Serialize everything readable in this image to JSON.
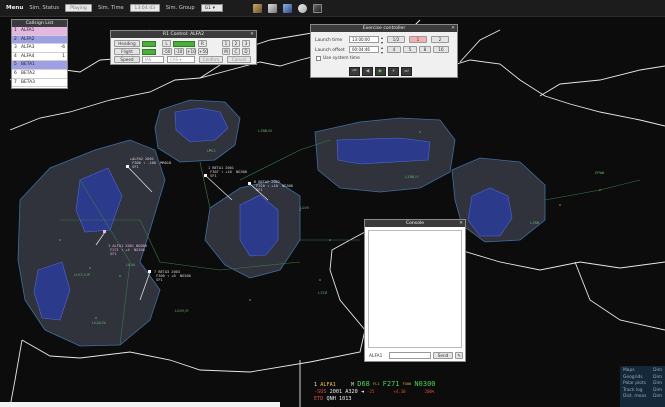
{
  "topbar": {
    "menu": "Menu",
    "sim_status_label": "Sim. Status",
    "sim_status_value": "Playing",
    "sim_time_label": "Sim. Time",
    "sim_time_value": "13:04:43",
    "sim_group_label": "Sim. Group",
    "sim_group_value": "G1"
  },
  "callsign_list": {
    "title": "Callsign List",
    "rows": [
      {
        "n": "1",
        "cs": "ALFA1",
        "extra": "",
        "color": "#e4b6e0"
      },
      {
        "n": "2",
        "cs": "ALFA2",
        "extra": "",
        "color": "#9ea0e6"
      },
      {
        "n": "3",
        "cs": "ALFA3",
        "extra": "-6",
        "color": "#ffffff"
      },
      {
        "n": "4",
        "cs": "ALFA4",
        "extra": "1",
        "color": "#ffffff"
      },
      {
        "n": "5",
        "cs": "BETA1",
        "extra": "",
        "color": "#9ea0e6"
      },
      {
        "n": "6",
        "cs": "BETA2",
        "extra": "",
        "color": "#ffffff"
      },
      {
        "n": "7",
        "cs": "BETA3",
        "extra": "",
        "color": "#ffffff"
      }
    ]
  },
  "r1_control": {
    "title": "R1 Control: ALFA2",
    "heading_label": "Heading",
    "flight_level_label": "Flight Level",
    "speed_label": "Speed",
    "speed_unit": "IAS",
    "speed_mode": "CAS",
    "confirm": "Confirm",
    "cancel": "Cancel",
    "heading_btns": [
      "L",
      "R"
    ],
    "heading_keys": [
      "1",
      "2",
      "3"
    ],
    "fl_btns": [
      "-50",
      "-10",
      "+10",
      "+50"
    ],
    "fl_keys": [
      "M",
      "C",
      "D"
    ]
  },
  "exercise": {
    "title": "Exercise controller",
    "launch_time_label": "Launch time",
    "launch_time_value": "13:00:00",
    "launch_offset_label": "Launch offset",
    "launch_offset_value": "00:04:46",
    "use_system_time_label": "Use system time",
    "speed_btns": [
      "1/2",
      "1",
      "2",
      "4",
      "5",
      "8",
      "16"
    ],
    "controls": [
      "skip-back",
      "back",
      "play",
      "pause",
      "forward"
    ]
  },
  "console": {
    "title": "Console",
    "callsign": "ALFA1",
    "input_placeholder": "",
    "send": "Send"
  },
  "strip": {
    "row1": {
      "n": "1",
      "cs": "ALFA1",
      "m": "M",
      "hdg": "D68",
      "fl_up": "FL1",
      "fl": "F271",
      "rate": "F300",
      "spd": "N0300"
    },
    "row2": {
      "sus": "-SUS",
      "reg": "2001",
      "type": "A320",
      "arrow": "◄",
      "delta": "-25",
      "vs": "+4.30",
      "pct": "200%"
    },
    "row3": {
      "etd": "ETD",
      "qnh": "QNH 1013"
    }
  },
  "tools": [
    {
      "name": "Maps",
      "value": "Dim"
    },
    {
      "name": "Geogrids",
      "value": "Dim"
    },
    {
      "name": "Polar plots",
      "value": "Dim"
    },
    {
      "name": "Track log",
      "value": "Dim"
    },
    {
      "name": "Dist. meas",
      "value": "Dim"
    }
  ],
  "aircraft_labels": [
    {
      "id": "alfa2",
      "text": "▸ALFA2 2002\n F300 ↑ -100  MR018\n SF1"
    },
    {
      "id": "alfa4",
      "text": "1 BETA1 2001\n F307 ↑ +10  NG300\n SF1"
    },
    {
      "id": "beta2",
      "text": "6 BETA2 2002\n F310 ↑ +10  NG300\n SF1"
    },
    {
      "id": "alfa1",
      "text": "1 ALFA1 2001 NG000\n F271 ↑ +4  NG300\n SF1"
    },
    {
      "id": "beta3",
      "text": "7 BETA3 2003\n F300 ↑ +0  NG300\n SF1"
    }
  ],
  "sector_labels": [
    "LHCC",
    "LKAA",
    "LHCC/UP",
    "LOVV",
    "LZBB",
    "LZBB/S",
    "EPWW",
    "LKAA/W",
    "LZIB",
    "LZBB/N",
    "LOVV/E"
  ],
  "colors": {
    "accent_green": "#4caf3c",
    "sector_green": "#5fa86a",
    "airspace_fill": "#30323c",
    "highlight_blue": "#2c3a8c"
  }
}
